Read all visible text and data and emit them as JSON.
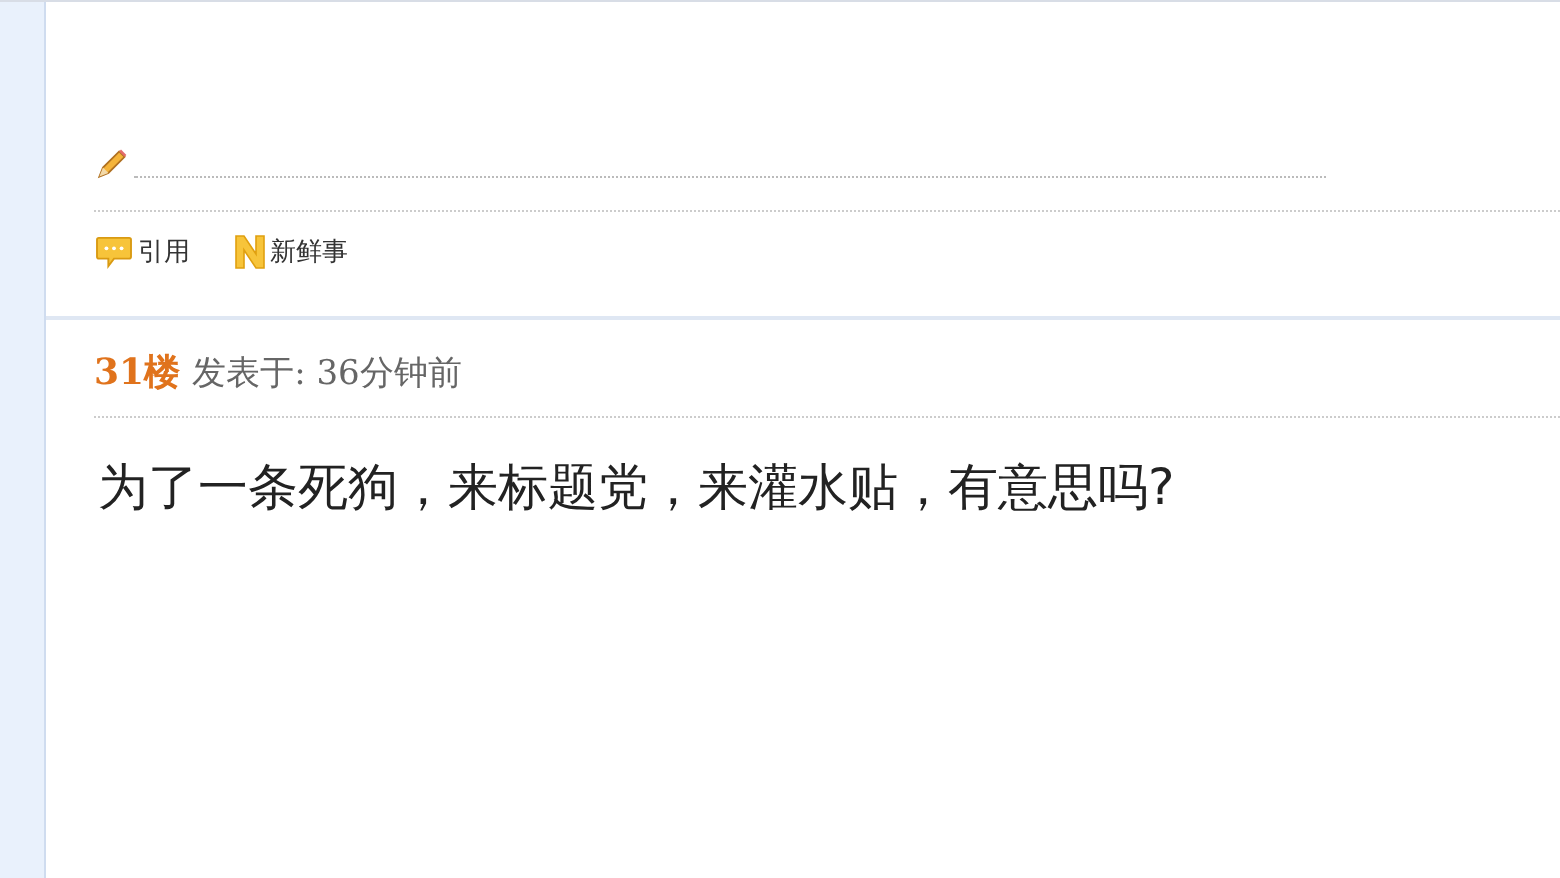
{
  "previous_post": {
    "actions": [
      {
        "kind": "quote",
        "label": "引用"
      },
      {
        "kind": "news",
        "label": "新鲜事"
      }
    ]
  },
  "post": {
    "floor": "31楼",
    "posted": "发表于: 36分钟前",
    "content": "为了一条死狗，来标题党，来灌水贴，有意思吗?"
  }
}
